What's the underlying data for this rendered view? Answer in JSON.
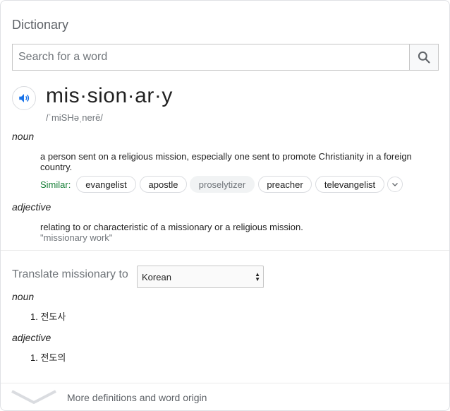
{
  "header": {
    "title": "Dictionary"
  },
  "search": {
    "placeholder": "Search for a word",
    "button_icon": "search-icon"
  },
  "entry": {
    "word": "mis·sion·ar·y",
    "phonetic": "/ˈmiSHəˌnerē/",
    "audio_icon": "speaker-icon",
    "senses": [
      {
        "pos": "noun",
        "definition": "a person sent on a religious mission, especially one sent to promote Christianity in a foreign country.",
        "similar_label": "Similar:",
        "similar": [
          "evangelist",
          "apostle",
          "proselytizer",
          "preacher",
          "televangelist"
        ]
      },
      {
        "pos": "adjective",
        "definition": "relating to or characteristic of a missionary or a religious mission.",
        "example": "\"missionary work\""
      }
    ]
  },
  "translate": {
    "label": "Translate missionary to",
    "language": "Korean",
    "results": [
      {
        "pos": "noun",
        "items": [
          "1. 전도사"
        ]
      },
      {
        "pos": "adjective",
        "items": [
          "1. 전도의"
        ]
      }
    ]
  },
  "footer": {
    "more_label": "More definitions and word origin"
  },
  "colors": {
    "similar_label": "#188038",
    "accent_blue": "#1a73e8"
  }
}
